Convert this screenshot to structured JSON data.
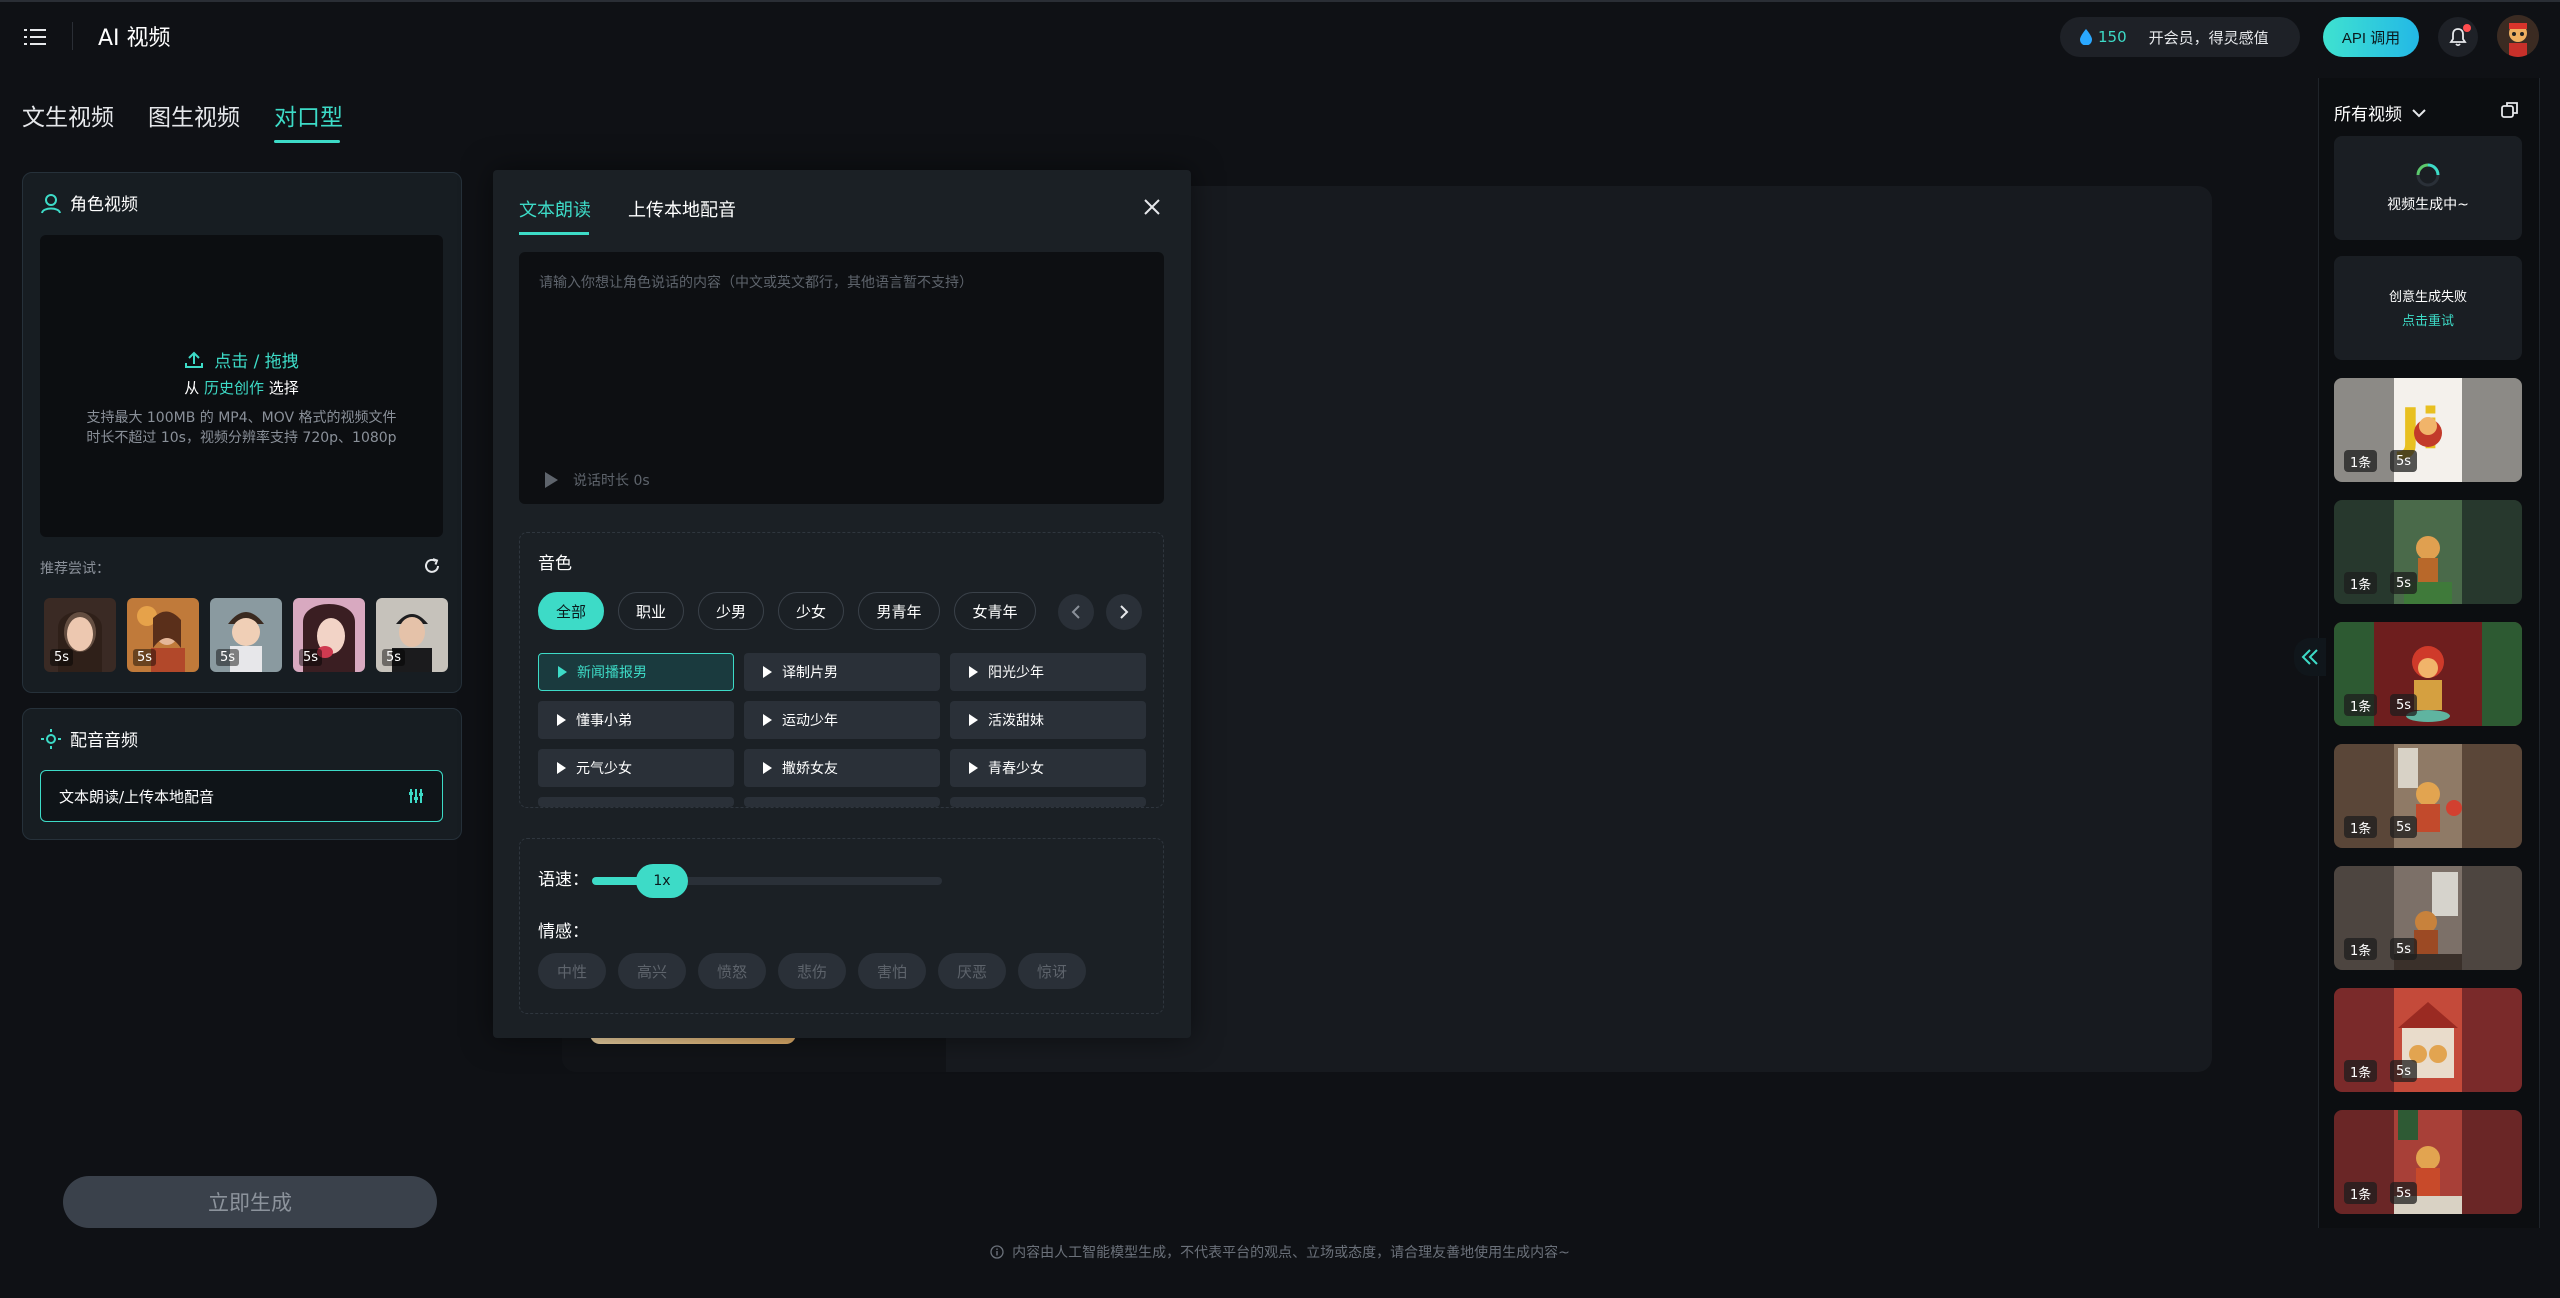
{
  "app": {
    "title": "AI 视频"
  },
  "header": {
    "credits": "150",
    "vip_text": "开会员，得灵感值",
    "api_label": "API 调用"
  },
  "tabs": [
    "文生视频",
    "图生视频",
    "对口型"
  ],
  "active_tab": "对口型",
  "character_panel": {
    "title": "角色视频",
    "upload_action": "点击 / 拖拽",
    "from_prefix": "从",
    "history_link": "历史创作",
    "select_suffix": "选择",
    "hint_line1": "支持最大 100MB 的 MP4、MOV 格式的视频文件",
    "hint_line2": "时长不超过 10s，视频分辨率支持 720p、1080p",
    "recommend_label": "推荐尝试：",
    "thumbs": [
      {
        "duration": "5s"
      },
      {
        "duration": "5s"
      },
      {
        "duration": "5s"
      },
      {
        "duration": "5s"
      },
      {
        "duration": "5s"
      }
    ]
  },
  "audio_panel": {
    "title": "配音音频",
    "field_value": "文本朗读/上传本地配音"
  },
  "generate_button": "立即生成",
  "dialog": {
    "tabs": [
      "文本朗读",
      "上传本地配音"
    ],
    "textarea_placeholder": "请输入你想让角色说话的内容（中文或英文都行，其他语言暂不支持）",
    "duration_text": "说话时长 0s",
    "voice_section_title": "音色",
    "categories": [
      "全部",
      "职业",
      "少男",
      "少女",
      "男青年",
      "女青年"
    ],
    "active_category": "全部",
    "voices": [
      "新闻播报男",
      "译制片男",
      "阳光少年",
      "懂事小弟",
      "运动少年",
      "活泼甜妹",
      "元气少女",
      "撒娇女友",
      "青春少女"
    ],
    "active_voice": "新闻播报男",
    "speed_label": "语速：",
    "speed_value": "1x",
    "speed_fraction": 0.2,
    "emotion_label": "情感：",
    "emotions": [
      "中性",
      "高兴",
      "愤怒",
      "悲伤",
      "害怕",
      "厌恶",
      "惊讶"
    ]
  },
  "sidebar": {
    "filter_label": "所有视频",
    "generating_text": "视频生成中~",
    "failed_text": "创意生成失败",
    "retry_link": "点击重试",
    "videos": [
      {
        "count": "1条",
        "duration": "5s"
      },
      {
        "count": "1条",
        "duration": "5s"
      },
      {
        "count": "1条",
        "duration": "5s"
      },
      {
        "count": "1条",
        "duration": "5s"
      },
      {
        "count": "1条",
        "duration": "5s"
      },
      {
        "count": "1条",
        "duration": "5s"
      },
      {
        "count": "1条",
        "duration": "5s"
      }
    ]
  },
  "footer": {
    "disclaimer": "内容由人工智能模型生成，不代表平台的观点、立场或态度，请合理友善地使用生成内容~"
  },
  "colors": {
    "accent": "#3ddbc7",
    "background": "#0f1115",
    "panel": "#171d22"
  }
}
